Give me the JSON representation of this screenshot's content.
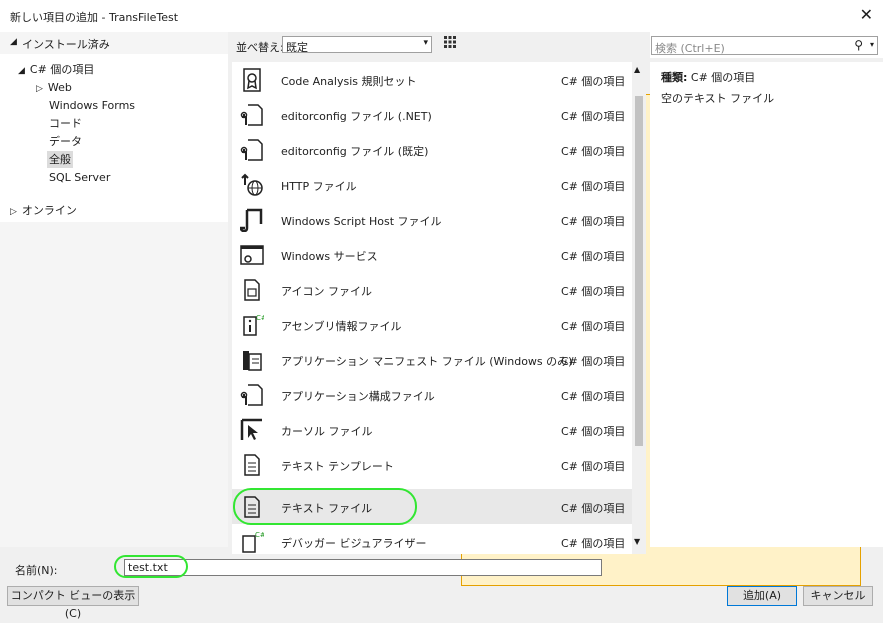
{
  "window": {
    "title": "新しい項目の追加 - TransFileTest",
    "close_glyph": "✕"
  },
  "tree": {
    "installed_label": "インストール済み",
    "nodes": [
      {
        "label": "C# 個の項目",
        "expanded": true
      },
      {
        "label": "Web",
        "collapsed": true
      },
      {
        "label": "Windows Forms"
      },
      {
        "label": "コード"
      },
      {
        "label": "データ"
      },
      {
        "label": "全般",
        "selected": true
      },
      {
        "label": "SQL Server"
      }
    ],
    "online_label": "オンライン"
  },
  "toolbar": {
    "sort_label": "並べ替え:",
    "sort_value": "既定"
  },
  "items": [
    {
      "name": "Code Analysis 規則セット",
      "lang": "C# 個の項目",
      "icon": "ribbon-icon"
    },
    {
      "name": "editorconfig ファイル (.NET)",
      "lang": "C# 個の項目",
      "icon": "wrench-doc-icon"
    },
    {
      "name": "editorconfig ファイル (既定)",
      "lang": "C# 個の項目",
      "icon": "wrench-doc-icon"
    },
    {
      "name": "HTTP ファイル",
      "lang": "C# 個の項目",
      "icon": "globe-arrow-icon"
    },
    {
      "name": "Windows Script Host ファイル",
      "lang": "C# 個の項目",
      "icon": "script-icon"
    },
    {
      "name": "Windows サービス",
      "lang": "C# 個の項目",
      "icon": "service-icon"
    },
    {
      "name": "アイコン ファイル",
      "lang": "C# 個の項目",
      "icon": "icon-file-icon"
    },
    {
      "name": "アセンブリ情報ファイル",
      "lang": "C# 個の項目",
      "icon": "info-doc-icon"
    },
    {
      "name": "アプリケーション マニフェスト ファイル (Windows のみ)",
      "lang": "C# 個の項目",
      "icon": "manifest-icon"
    },
    {
      "name": "アプリケーション構成ファイル",
      "lang": "C# 個の項目",
      "icon": "wrench-doc-icon"
    },
    {
      "name": "カーソル ファイル",
      "lang": "C# 個の項目",
      "icon": "cursor-icon"
    },
    {
      "name": "テキスト テンプレート",
      "lang": "C# 個の項目",
      "icon": "text-doc-icon"
    },
    {
      "name": "テキスト ファイル",
      "lang": "C# 個の項目",
      "icon": "text-doc-icon",
      "selected": true
    },
    {
      "name": "デバッガー ビジュアライザー",
      "lang": "C# 個の項目",
      "icon": "visualizer-icon"
    }
  ],
  "search": {
    "placeholder": "検索 (Ctrl+E)"
  },
  "details": {
    "type_label": "種類:",
    "type_value": "C# 個の項目",
    "description": "空のテキスト ファイル"
  },
  "name_field": {
    "label": "名前(N):",
    "value": "test.txt"
  },
  "buttons": {
    "compact": "コンパクト ビューの表示(C)",
    "add": "追加(A)",
    "cancel": "キャンセル"
  },
  "colors": {
    "highlight": "#32e632",
    "selected_row": "#e8e8e8",
    "accent": "#0078d7"
  }
}
